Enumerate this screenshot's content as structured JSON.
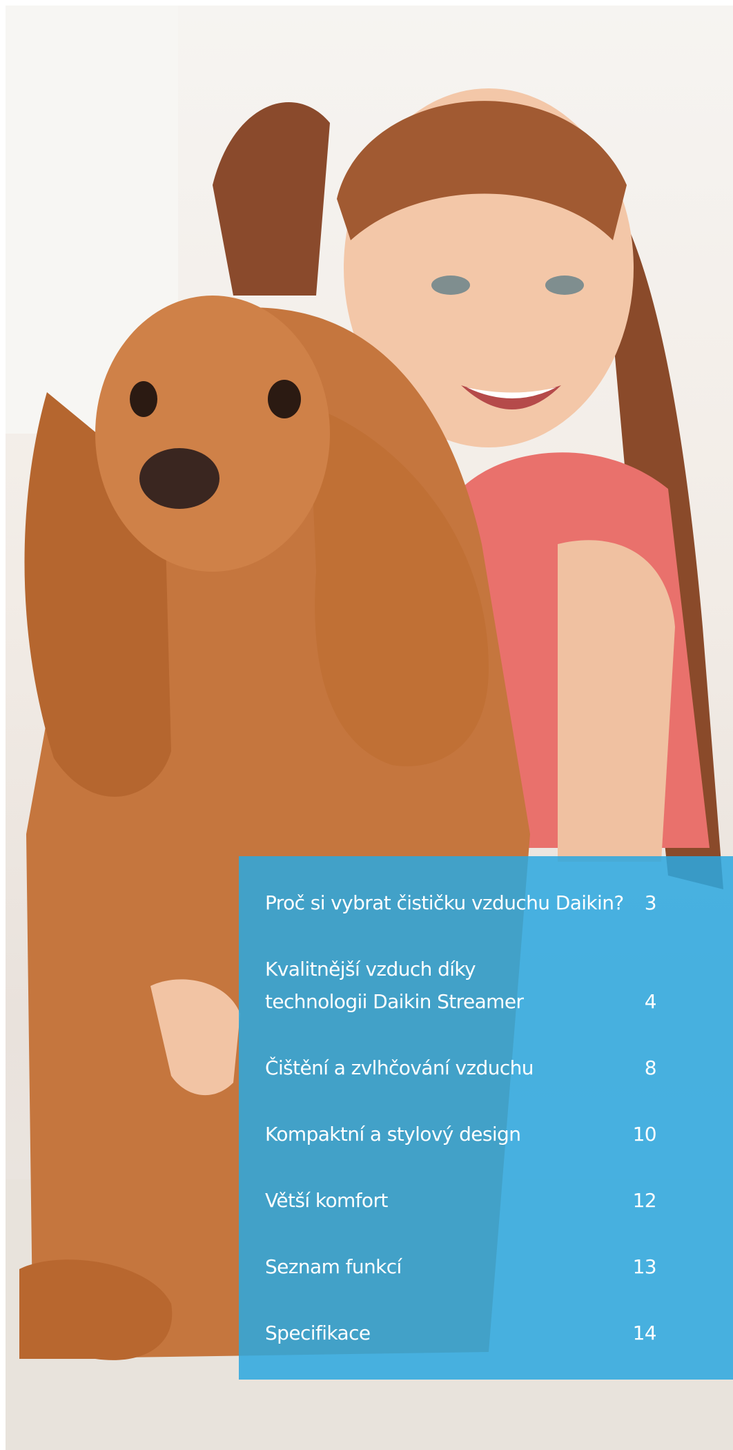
{
  "toc": {
    "items": [
      {
        "title_lines": [
          "Proč si vybrat čističku vzduchu Daikin?"
        ],
        "page": "3"
      },
      {
        "title_lines": [
          "Kvalitnější vzduch díky",
          "technologii Daikin Streamer"
        ],
        "page": "4"
      },
      {
        "title_lines": [
          "Čištění a zvlhčování vzduchu"
        ],
        "page": "8"
      },
      {
        "title_lines": [
          "Kompaktní a stylový design"
        ],
        "page": "10"
      },
      {
        "title_lines": [
          "Větší komfort"
        ],
        "page": "12"
      },
      {
        "title_lines": [
          "Seznam funkcí"
        ],
        "page": "13"
      },
      {
        "title_lines": [
          "Specifikace"
        ],
        "page": "14"
      }
    ]
  },
  "colors": {
    "toc_background": "#2ca8e0",
    "text": "#ffffff"
  }
}
